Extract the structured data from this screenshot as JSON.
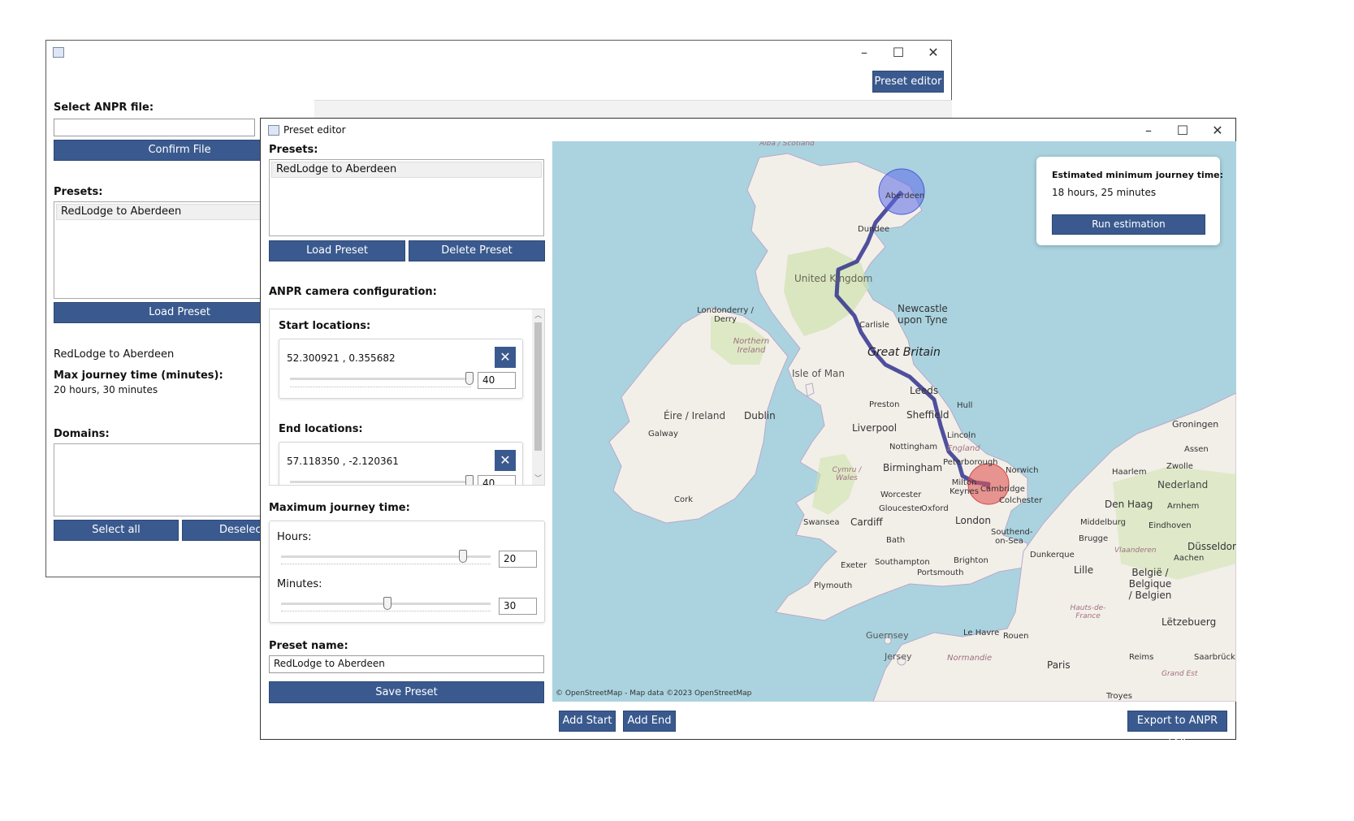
{
  "main_window": {
    "preset_editor_button": "Preset editor",
    "select_file_label": "Select ANPR file:",
    "file_input_value": "",
    "confirm_file_button": "Confirm File",
    "presets_label": "Presets:",
    "presets": [
      "RedLodge to Aberdeen"
    ],
    "load_preset_button": "Load Preset",
    "selected_preset_name": "RedLodge to Aberdeen",
    "max_journey_label": "Max journey time (minutes):",
    "max_journey_value": "20 hours, 30 minutes",
    "domains_label": "Domains:",
    "select_all_button": "Select all",
    "deselect_all_button": "Deselect a"
  },
  "editor": {
    "title": "Preset editor",
    "presets_label": "Presets:",
    "presets": [
      "RedLodge to Aberdeen"
    ],
    "load_preset_button": "Load Preset",
    "delete_preset_button": "Delete Preset",
    "camera_config_label": "ANPR camera configuration:",
    "start_locations_label": "Start locations:",
    "start_locations": [
      {
        "coords": "52.300921 ,  0.355682",
        "radius": "40",
        "slider_fraction": 1.0
      }
    ],
    "end_locations_label": "End locations:",
    "end_locations": [
      {
        "coords": "57.118350 ,  -2.120361",
        "radius": "40",
        "slider_fraction": 1.0
      }
    ],
    "max_time_label": "Maximum journey time:",
    "hours_label": "Hours:",
    "hours_value": "20",
    "hours_fraction": 0.87,
    "minutes_label": "Minutes:",
    "minutes_value": "30",
    "minutes_fraction": 0.5,
    "preset_name_label": "Preset name:",
    "preset_name_value": "RedLodge to Aberdeen",
    "save_preset_button": "Save Preset",
    "add_start_button": "Add Start",
    "add_end_button": "Add End",
    "export_button": "Export to ANPR csv",
    "estimate_title": "Estimated minimum journey time:",
    "estimate_value": "18 hours, 25 minutes",
    "run_estimation_button": "Run estimation",
    "map_attribution": "© OpenStreetMap - Map data ©2023 OpenStreetMap",
    "map_labels": {
      "alba": "Alba / Scotland",
      "aberdeen": "Aberdeen",
      "dundee": "Dundee",
      "uk": "United Kingdom",
      "londonderry": "Londonderry / Derry",
      "northern_ireland": "Northern Ireland",
      "newcastle": "Newcastle upon Tyne",
      "carlisle": "Carlisle",
      "great_britain": "Great Britain",
      "isle_of_man": "Isle of Man",
      "leeds": "Leeds",
      "hull": "Hull",
      "preston": "Preston",
      "sheffield": "Sheffield",
      "eire": "Éire / Ireland",
      "dublin": "Dublin",
      "liverpool": "Liverpool",
      "lincoln": "Lincoln",
      "galway": "Galway",
      "nottingham": "Nottingham",
      "england": "England",
      "peterborough": "Peterborough",
      "norwich": "Norwich",
      "cymru": "Cymru / Wales",
      "birmingham": "Birmingham",
      "milton_keynes": "Milton Keynes",
      "cambridge": "Cambridge",
      "colchester": "Colchester",
      "cork": "Cork",
      "worcester": "Worcester",
      "gloucester": "Gloucester",
      "oxford": "Oxford",
      "swansea": "Swansea",
      "cardiff": "Cardiff",
      "london": "London",
      "southend": "Southend-on-Sea",
      "bath": "Bath",
      "exeter": "Exeter",
      "southampton": "Southampton",
      "brighton": "Brighton",
      "portsmouth": "Portsmouth",
      "plymouth": "Plymouth",
      "guernsey": "Guernsey",
      "jersey": "Jersey",
      "normandie": "Normandie",
      "le_havre": "Le Havre",
      "rouen": "Rouen",
      "paris": "Paris",
      "troyes": "Troyes",
      "dunkerque": "Dunkerque",
      "lille": "Lille",
      "belgie": "België / Belgique / Belgien",
      "hauts_de_france": "Hauts-de-France",
      "reims": "Reims",
      "grand_est": "Grand Est",
      "groningen": "Groningen",
      "assen": "Assen",
      "zwolle": "Zwolle",
      "haarlem": "Haarlem",
      "nederland": "Nederland",
      "den_haag": "Den Haag",
      "arnhem": "Arnhem",
      "eindhoven": "Eindhoven",
      "middelburg": "Middelburg",
      "brugge": "Brugge",
      "vlaanderen": "Vlaanderen",
      "aachen": "Aachen",
      "dusseldorf": "Düsseldorf",
      "letzebuerg": "Lëtzebuerg",
      "saarbrucken": "Saarbrück"
    }
  }
}
